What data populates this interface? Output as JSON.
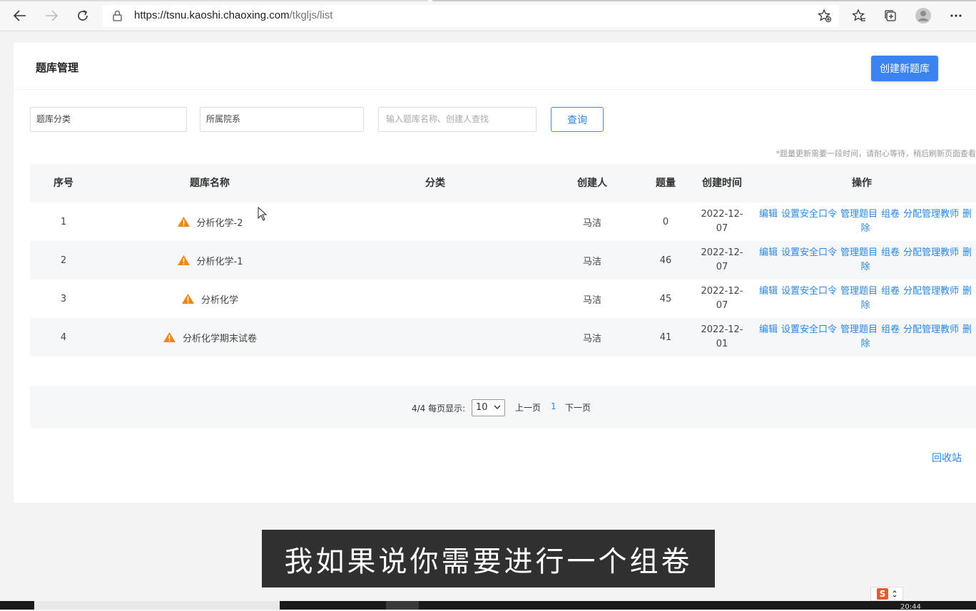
{
  "browser": {
    "url_host": "https://tsnu.kaoshi.chaoxing.com",
    "url_path": "/tkgljs/list",
    "icons": [
      "back-icon",
      "forward-icon",
      "refresh-icon",
      "lock-icon",
      "add-favorite-icon",
      "favorites-icon",
      "collections-icon",
      "profile-icon",
      "more-icon"
    ]
  },
  "page": {
    "title": "题库管理",
    "create_button": "创建新题库"
  },
  "filters": {
    "category": "题库分类",
    "department": "所属院系",
    "search_placeholder": "输入题库名称、创建人查找",
    "query_button": "查询"
  },
  "hint": "*题量更新需要一段时间，请耐心等待，稍后刷新页面查看",
  "table": {
    "headers": {
      "index": "序号",
      "name": "题库名称",
      "category": "分类",
      "creator": "创建人",
      "count": "题量",
      "created": "创建时间",
      "actions": "操作"
    },
    "rows": [
      {
        "index": "1",
        "name": "分析化学-2",
        "category": "",
        "creator": "马洁",
        "count": "0",
        "date_line1": "2022-12-",
        "date_line2": "07"
      },
      {
        "index": "2",
        "name": "分析化学-1",
        "category": "",
        "creator": "马洁",
        "count": "46",
        "date_line1": "2022-12-",
        "date_line2": "07"
      },
      {
        "index": "3",
        "name": "分析化学",
        "category": "",
        "creator": "马洁",
        "count": "45",
        "date_line1": "2022-12-",
        "date_line2": "07"
      },
      {
        "index": "4",
        "name": "分析化学期末试卷",
        "category": "",
        "creator": "马洁",
        "count": "41",
        "date_line1": "2022-12-",
        "date_line2": "01"
      }
    ],
    "actions": {
      "edit": "编辑",
      "set_password": "设置安全口令",
      "manage_questions": "管理题目",
      "compose": "组卷",
      "assign_teacher": "分配管理教师",
      "delete": "删除"
    }
  },
  "pager": {
    "info": "4/4 每页显示:",
    "page_size": "10",
    "prev": "上一页",
    "current": "1",
    "next": "下一页"
  },
  "recycle_bin": "回收站",
  "subtitle": "我如果说你需要进行一个组卷",
  "taskbar": {
    "clock": "20:44",
    "ime_label": "S"
  },
  "colors": {
    "accent": "#3a83f1",
    "link": "#2b87e3",
    "warning": "#f0860b"
  }
}
